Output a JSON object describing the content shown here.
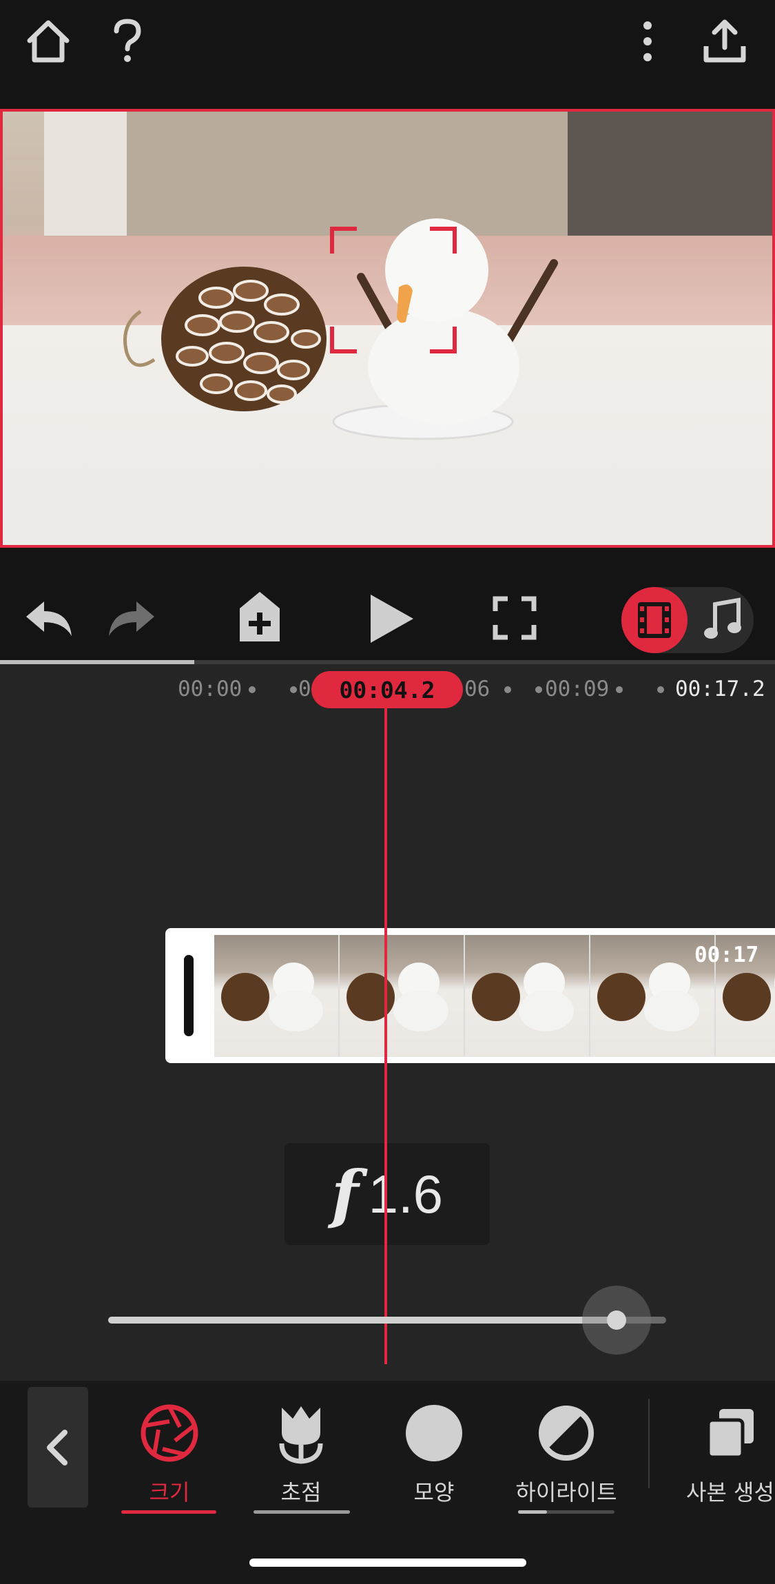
{
  "topbar": {
    "icons": [
      "home-icon",
      "help-icon",
      "more-vert-icon",
      "export-icon"
    ]
  },
  "preview": {
    "selected_color": "#e0283f"
  },
  "controls": {
    "icons": [
      "undo-icon",
      "redo-icon",
      "add-keyframe-icon",
      "play-icon",
      "fullscreen-icon",
      "film-mode-icon",
      "music-mode-icon"
    ],
    "active_mode": "film"
  },
  "timeline": {
    "ruler": [
      "00:00",
      "00:0",
      "06",
      "00:09",
      "00:17.2"
    ],
    "current_time": "00:04.2",
    "clip_duration": "00:17",
    "progress_fraction": 0.25
  },
  "aperture": {
    "symbol": "f",
    "value": "1.6",
    "slider_fraction": 0.9
  },
  "toolbar": {
    "items": [
      {
        "label": "크기",
        "icon": "aperture-icon",
        "active": true
      },
      {
        "label": "초점",
        "icon": "focus-flower-icon",
        "active": false
      },
      {
        "label": "모양",
        "icon": "shape-circle-icon",
        "active": false
      },
      {
        "label": "하이라이트",
        "icon": "highlight-icon",
        "active": false
      },
      {
        "label": "사본 생성",
        "icon": "duplicate-icon",
        "active": false
      }
    ],
    "accent": "#e0283f"
  }
}
